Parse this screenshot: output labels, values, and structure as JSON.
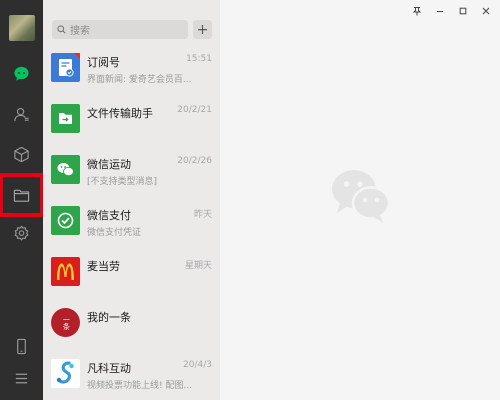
{
  "search": {
    "placeholder": "搜索"
  },
  "add_button": {
    "label": "+"
  },
  "conversations": [
    {
      "title": "订阅号",
      "time": "15:51",
      "subtitle": "界面新闻: 爱奇艺会员百...",
      "icon": "subscription-icon",
      "color": "#3d7ad6"
    },
    {
      "title": "文件传输助手",
      "time": "20/2/21",
      "subtitle": "",
      "icon": "file-transfer-icon",
      "color": "#2ea44b"
    },
    {
      "title": "微信运动",
      "time": "20/2/26",
      "subtitle": "[不支持类型消息]",
      "icon": "wechat-sport-icon",
      "color": "#2ea44b"
    },
    {
      "title": "微信支付",
      "time": "昨天",
      "subtitle": "微信支付凭证",
      "icon": "wechat-pay-icon",
      "color": "#2ea44b"
    },
    {
      "title": "麦当劳",
      "time": "星期天",
      "subtitle": "",
      "icon": "mcdonalds-logo-icon",
      "color": "#da1e1e"
    },
    {
      "title": "我的一条",
      "time": "",
      "subtitle": "",
      "icon": "yitiao-logo-icon",
      "color": "#b3202a",
      "icon_text": "一条"
    },
    {
      "title": "凡科互动",
      "time": "20/4/3",
      "subtitle": "视频投票功能上线! 配图...",
      "icon": "fanke-logo-icon",
      "color": "#3a9ad9"
    }
  ],
  "nav": [
    "avatar",
    "chat-icon",
    "contacts-icon",
    "cube-icon",
    "folder-icon",
    "settings-icon",
    "phone-icon",
    "menu-icon"
  ],
  "window_controls": [
    "pin-icon",
    "minimize-icon",
    "maximize-icon",
    "close-icon"
  ],
  "colors": {
    "nav_bg": "#2e2e2e",
    "list_bg": "#ebeae9",
    "main_bg": "#f5f5f5",
    "accent_green": "#07c160",
    "highlight_red": "#e60012"
  }
}
